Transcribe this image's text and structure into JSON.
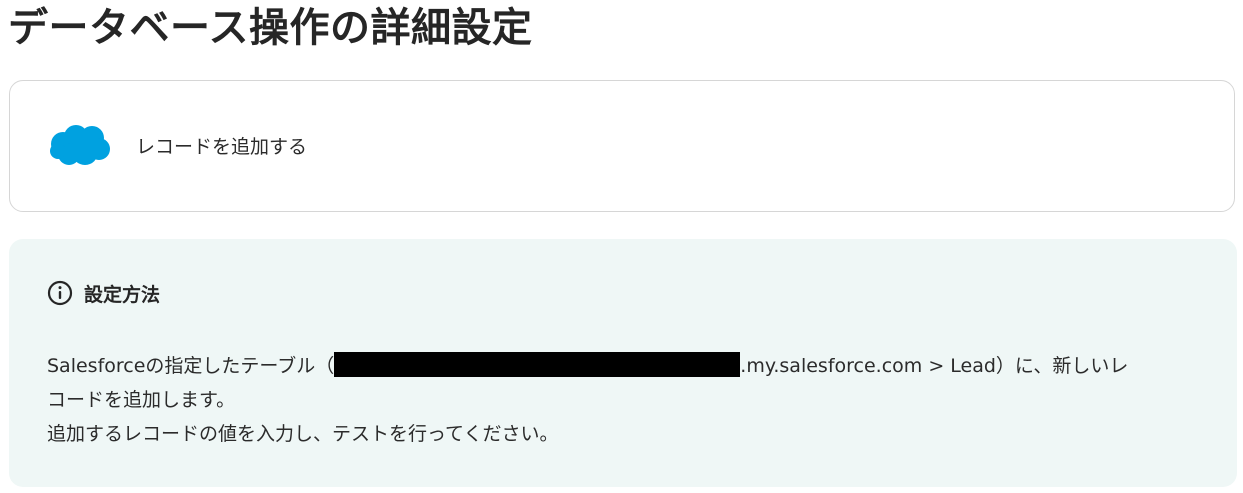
{
  "page": {
    "title": "データベース操作の詳細設定"
  },
  "action_card": {
    "app_icon": "salesforce-cloud-logo",
    "app_color": "#00A1E0",
    "label": "レコードを追加する"
  },
  "info": {
    "icon": "info-circle-icon",
    "title": "設定方法",
    "line1_before": "Salesforceの指定したテーブル（",
    "line1_after": ".my.salesforce.com > Lead）に、新しいレ",
    "line2": "コードを追加します。",
    "line3": "追加するレコードの値を入力し、テストを行ってください。",
    "background_color": "#EFF7F6"
  }
}
